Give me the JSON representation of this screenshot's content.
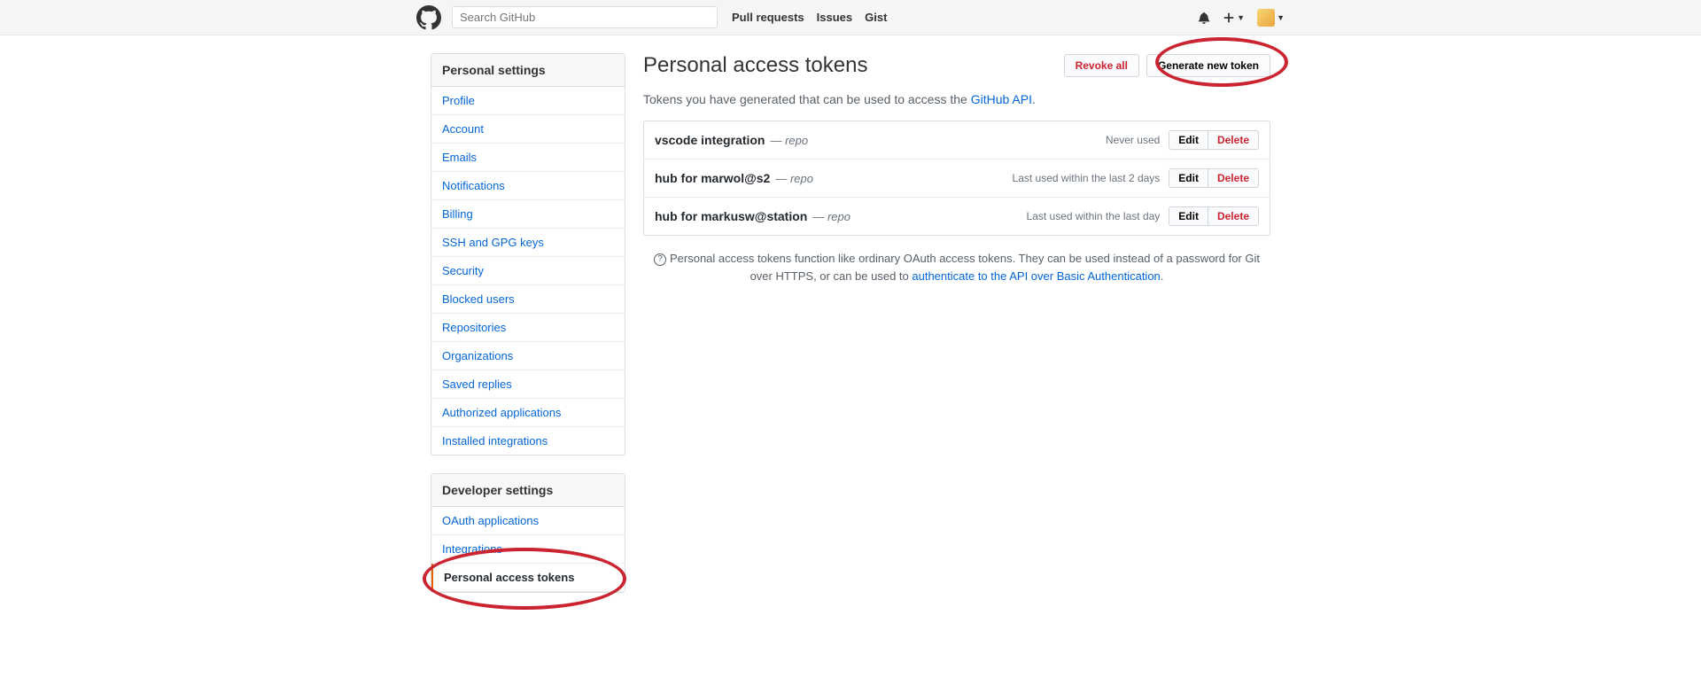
{
  "header": {
    "search_placeholder": "Search GitHub",
    "nav": [
      "Pull requests",
      "Issues",
      "Gist"
    ]
  },
  "sidebar": {
    "personal": {
      "title": "Personal settings",
      "items": [
        "Profile",
        "Account",
        "Emails",
        "Notifications",
        "Billing",
        "SSH and GPG keys",
        "Security",
        "Blocked users",
        "Repositories",
        "Organizations",
        "Saved replies",
        "Authorized applications",
        "Installed integrations"
      ]
    },
    "developer": {
      "title": "Developer settings",
      "items": [
        "OAuth applications",
        "Integrations",
        "Personal access tokens"
      ],
      "selected_index": 2
    }
  },
  "main": {
    "title": "Personal access tokens",
    "revoke_label": "Revoke all",
    "generate_label": "Generate new token",
    "desc_pre": "Tokens you have generated that can be used to access the ",
    "desc_link": "GitHub API",
    "desc_post": ".",
    "tokens": [
      {
        "name": "vscode integration",
        "scope": "repo",
        "used": "Never used",
        "edit": "Edit",
        "delete": "Delete"
      },
      {
        "name": "hub for marwol@s2",
        "scope": "repo",
        "used": "Last used within the last 2 days",
        "edit": "Edit",
        "delete": "Delete"
      },
      {
        "name": "hub for markusw@station",
        "scope": "repo",
        "used": "Last used within the last day",
        "edit": "Edit",
        "delete": "Delete"
      }
    ],
    "note_pre": "Personal access tokens function like ordinary OAuth access tokens. They can be used instead of a password for Git over HTTPS, or can be used to ",
    "note_link": "authenticate to the API over Basic Authentication",
    "note_post": "."
  }
}
